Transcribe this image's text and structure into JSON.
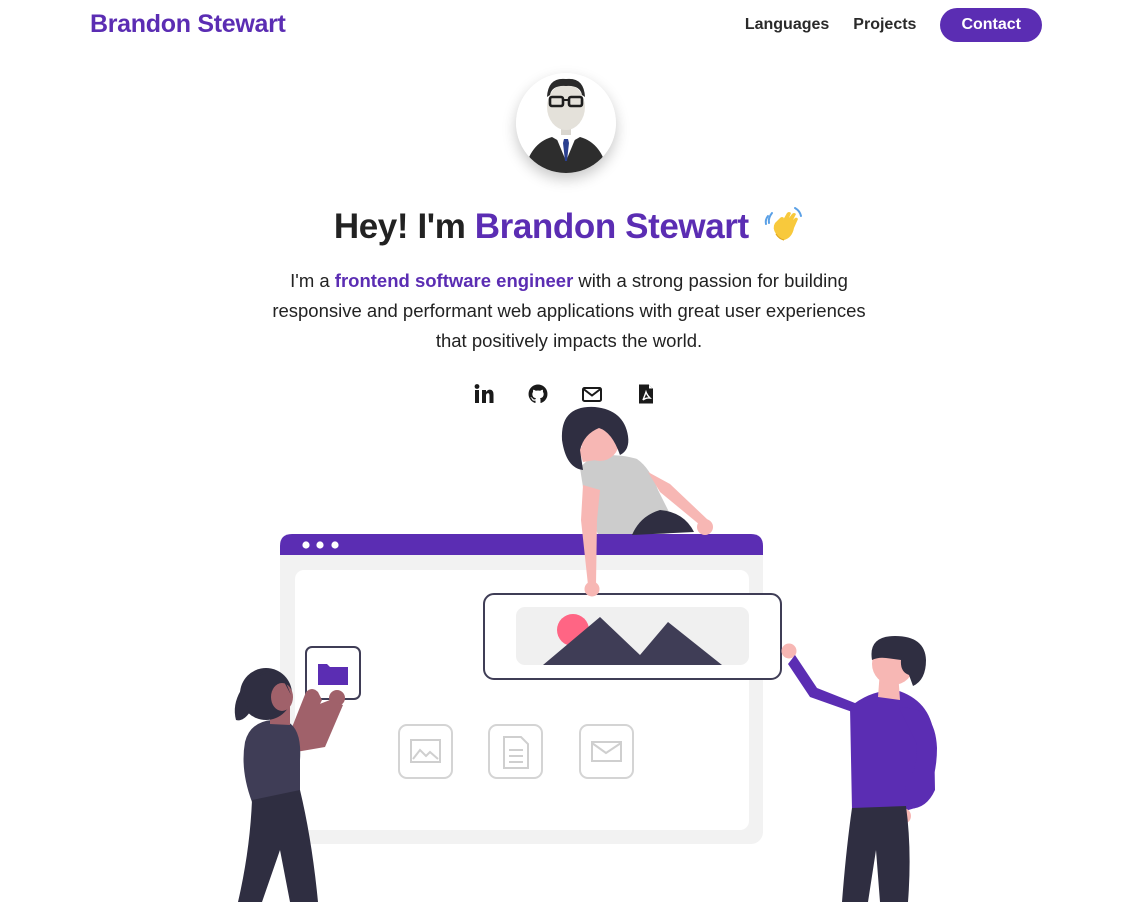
{
  "nav": {
    "brand": "Brandon Stewart",
    "links": [
      "Languages",
      "Projects"
    ],
    "contact": "Contact"
  },
  "hero": {
    "greeting": "Hey! I'm ",
    "name": "Brandon Stewart",
    "wave_icon": "waving-hand-icon",
    "intro_prefix": "I'm a ",
    "intro_highlight": "frontend software engineer",
    "intro_suffix": " with a strong passion for building responsive and performant web applications with great user experiences that positively impacts the world."
  },
  "socials": [
    {
      "icon": "linkedin-icon"
    },
    {
      "icon": "github-icon"
    },
    {
      "icon": "mail-icon"
    },
    {
      "icon": "pdf-resume-icon"
    }
  ],
  "colors": {
    "accent": "#5b2db3",
    "text": "#222222",
    "skin_pink": "#f7b7b4",
    "dark": "#2f2e41"
  }
}
